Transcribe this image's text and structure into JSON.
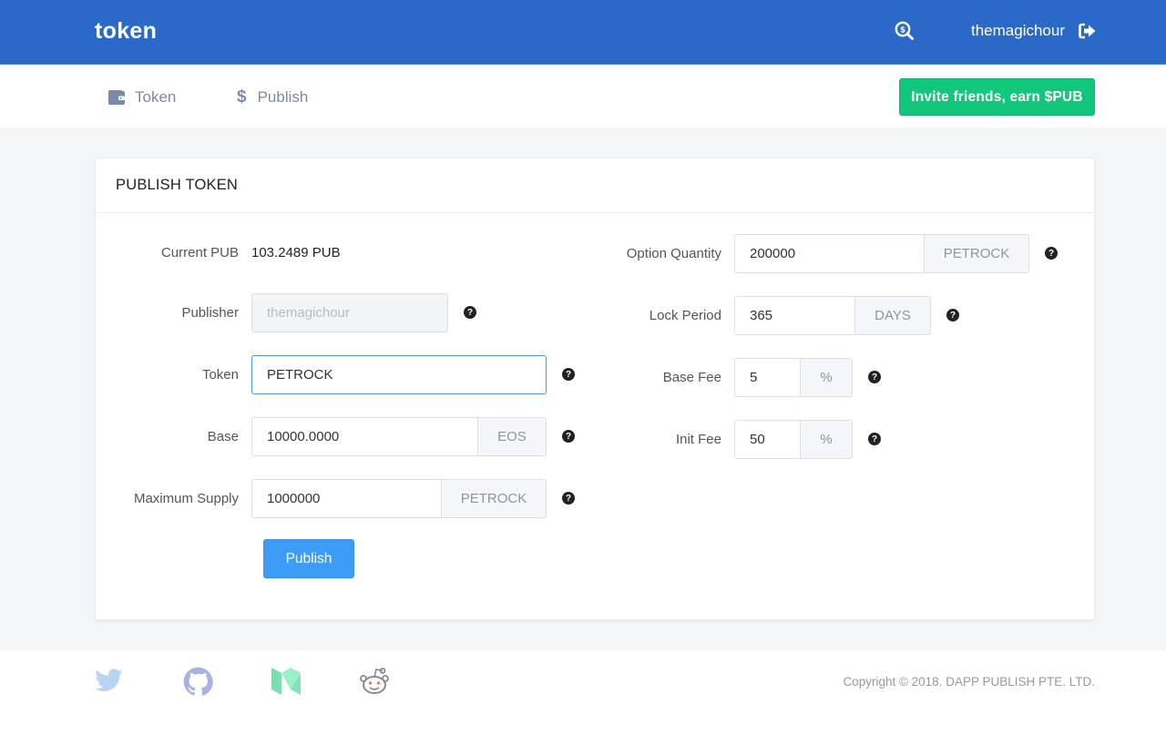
{
  "header": {
    "brand": "token",
    "search_icon": "search-dollar-icon",
    "username": "themagichour",
    "logout_icon": "sign-out-icon"
  },
  "nav": {
    "items": [
      {
        "label": "Token",
        "icon": "wallet-icon"
      },
      {
        "label": "Publish",
        "icon": "dollar-icon"
      }
    ],
    "invite_button": "Invite friends, earn $PUB"
  },
  "colors": {
    "topbar": "#2b69c9",
    "invite": "#12c67c",
    "primary_button": "#3d9cf5",
    "nav_text": "#7b8aa6"
  },
  "form": {
    "title": "PUBLISH TOKEN",
    "left": {
      "current_pub": {
        "label": "Current PUB",
        "value": "103.2489 PUB"
      },
      "publisher": {
        "label": "Publisher",
        "placeholder": "themagichour"
      },
      "token": {
        "label": "Token",
        "value": "PETROCK"
      },
      "base": {
        "label": "Base",
        "value": "10000.0000",
        "unit": "EOS"
      },
      "max_supply": {
        "label": "Maximum Supply",
        "value": "1000000",
        "unit": "PETROCK"
      }
    },
    "right": {
      "option_quantity": {
        "label": "Option Quantity",
        "value": "200000",
        "unit": "PETROCK"
      },
      "lock_period": {
        "label": "Lock Period",
        "value": "365",
        "unit": "DAYS"
      },
      "base_fee": {
        "label": "Base Fee",
        "value": "5",
        "unit": "%"
      },
      "init_fee": {
        "label": "Init Fee",
        "value": "50",
        "unit": "%"
      }
    },
    "help_glyph": "?",
    "submit_label": "Publish"
  },
  "footer": {
    "social": [
      {
        "name": "twitter",
        "color": "#b9d3f5"
      },
      {
        "name": "github",
        "color": "#a9b2e0"
      },
      {
        "name": "medium",
        "color": "#86e3b7"
      },
      {
        "name": "reddit",
        "color": "#8a8a8a"
      }
    ],
    "copyright": "Copyright © 2018. DAPP PUBLISH PTE. LTD."
  }
}
